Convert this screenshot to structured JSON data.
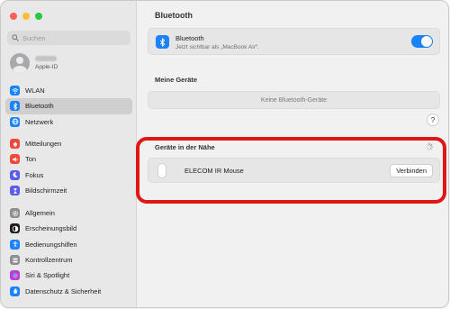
{
  "window": {
    "traffic_lights": [
      "close",
      "minimize",
      "zoom"
    ]
  },
  "sidebar": {
    "search_placeholder": "Suchen",
    "account": {
      "subtitle": "Apple-ID"
    },
    "groups": [
      [
        {
          "label": "WLAN",
          "icon": "wifi-icon",
          "color": "#1a82fb"
        },
        {
          "label": "Bluetooth",
          "icon": "bluetooth-icon",
          "color": "#1a82fb",
          "active": true
        },
        {
          "label": "Netzwerk",
          "icon": "globe-icon",
          "color": "#1a82fb"
        }
      ],
      [
        {
          "label": "Mitteilungen",
          "icon": "bell-icon",
          "color": "#f2473a"
        },
        {
          "label": "Ton",
          "icon": "speaker-icon",
          "color": "#f2473a"
        },
        {
          "label": "Fokus",
          "icon": "moon-icon",
          "color": "#5e5ce6"
        },
        {
          "label": "Bildschirmzeit",
          "icon": "hourglass-icon",
          "color": "#5e5ce6"
        }
      ],
      [
        {
          "label": "Allgemein",
          "icon": "gear-icon",
          "color": "#8e8e93"
        },
        {
          "label": "Erscheinungsbild",
          "icon": "appearance-icon",
          "color": "#1d1d1f"
        },
        {
          "label": "Bedienungshilfen",
          "icon": "accessibility-icon",
          "color": "#1a82fb"
        },
        {
          "label": "Kontrollzentrum",
          "icon": "control-center-icon",
          "color": "#8e8e93"
        },
        {
          "label": "Siri & Spotlight",
          "icon": "siri-icon",
          "color": "#b141d8"
        },
        {
          "label": "Datenschutz & Sicherheit",
          "icon": "hand-icon",
          "color": "#1a82fb"
        }
      ]
    ]
  },
  "main": {
    "title": "Bluetooth",
    "bluetooth": {
      "label": "Bluetooth",
      "subtitle": "Jetzt sichtbar als „MacBook Air“.",
      "enabled": true
    },
    "my_devices": {
      "title": "Meine Geräte",
      "empty": "Keine Bluetooth-Geräte"
    },
    "help_label": "?",
    "nearby": {
      "title": "Geräte in der Nähe",
      "devices": [
        {
          "name": "ELECOM IR Mouse",
          "action": "Verbinden"
        }
      ]
    }
  },
  "colors": {
    "accent": "#1a82fb",
    "highlight": "#e01717"
  }
}
